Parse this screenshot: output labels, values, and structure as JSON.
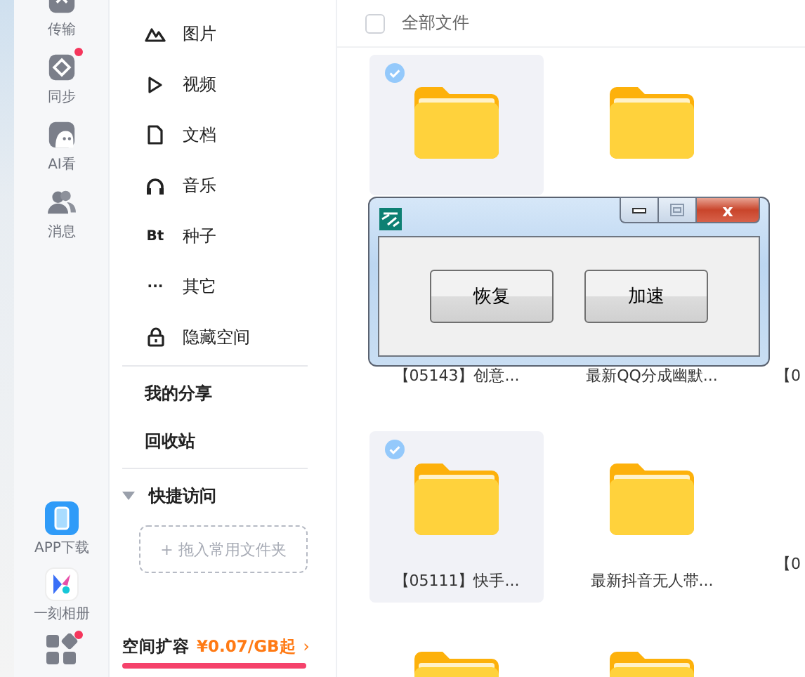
{
  "nav_rail": {
    "top_items": [
      {
        "label": "传输"
      },
      {
        "label": "同步",
        "badge": true
      },
      {
        "label": "AI看",
        "badge": false
      },
      {
        "label": "消息",
        "badge": false
      }
    ],
    "bottom_items": [
      {
        "label": "APP下载",
        "badge": false
      },
      {
        "label": "一刻相册",
        "badge": false
      },
      {
        "badge": true
      }
    ]
  },
  "sidebar": {
    "categories": [
      {
        "label": "图片"
      },
      {
        "label": "视频"
      },
      {
        "label": "文档"
      },
      {
        "label": "音乐"
      },
      {
        "label": "种子",
        "glyph": "Bt"
      },
      {
        "label": "其它",
        "glyph": "···"
      },
      {
        "label": "隐藏空间"
      }
    ],
    "links": [
      "我的分享",
      "回收站"
    ],
    "quick_access": {
      "title": "快捷访问",
      "expanded": true,
      "drop_zone": "+ 拖入常用文件夹"
    },
    "promo": {
      "label": "空间扩容",
      "price": "¥0.07/GB起",
      "arrow": "›"
    }
  },
  "main": {
    "header": {
      "checked": false,
      "title": "全部文件"
    },
    "rows": [
      {
        "items": [
          {
            "kind": "icon",
            "selected": true
          },
          {
            "kind": "icon",
            "selected": false
          }
        ]
      },
      {
        "items": [
          {
            "kind": "label",
            "selected": false,
            "name": "【05143】创意..."
          },
          {
            "kind": "label",
            "selected": false,
            "name": "最新QQ分成幽默..."
          },
          {
            "kind": "edge",
            "name": "【0"
          }
        ]
      },
      {
        "items": [
          {
            "kind": "full",
            "selected": true,
            "name": "【05111】快手..."
          },
          {
            "kind": "full",
            "selected": false,
            "name": "最新抖音无人带..."
          },
          {
            "kind": "edge",
            "name": "【0"
          }
        ]
      },
      {
        "items": [
          {
            "kind": "icon",
            "selected": false
          },
          {
            "kind": "icon",
            "selected": false
          }
        ]
      }
    ]
  },
  "dialog": {
    "buttons": [
      "恢复",
      "加速"
    ],
    "close": "x"
  }
}
